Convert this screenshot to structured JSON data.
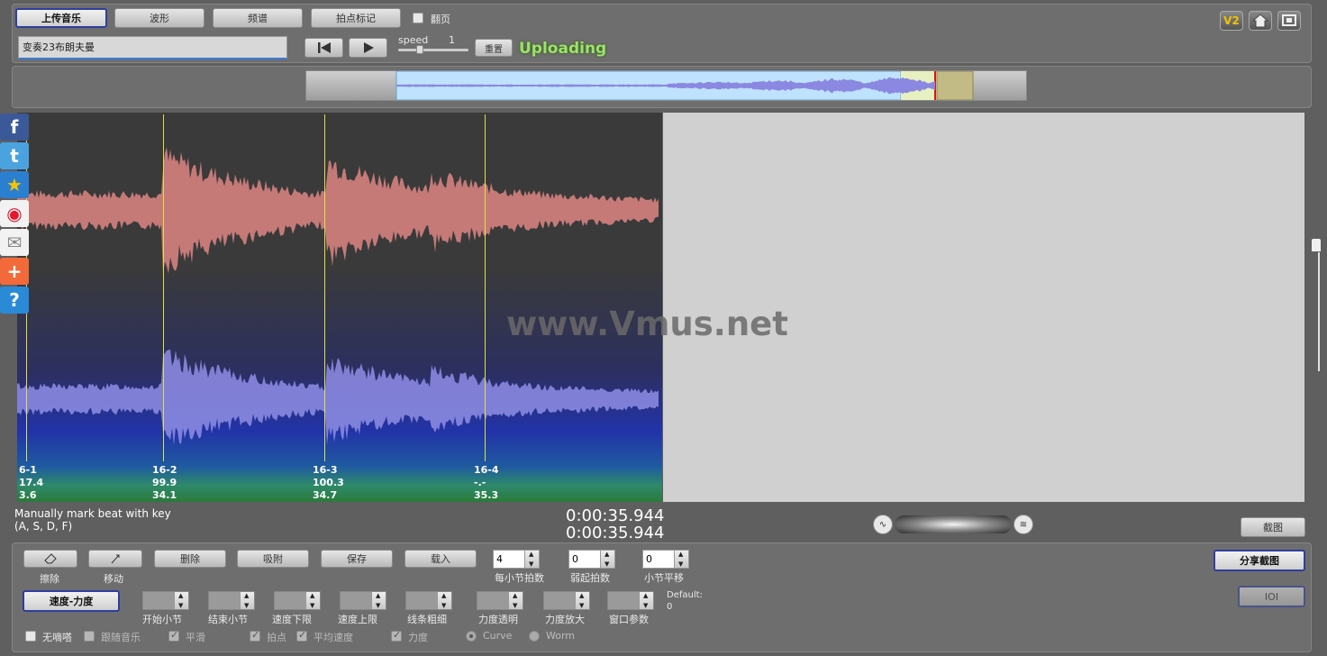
{
  "toolbar": {
    "upload": "上传音乐",
    "waveform": "波形",
    "spectrum": "频谱",
    "beat_mark": "拍点标记",
    "page_turn": "翻页",
    "file_name": "变奏23布朗夫曼",
    "speed_label": "speed",
    "speed_value": "1",
    "reset": "重置",
    "status": "Uploading",
    "v2": "V2"
  },
  "watermark": "www.Vmus.net",
  "beats": [
    {
      "id": "6-1",
      "tempo": "17.4",
      "force": "3.6"
    },
    {
      "id": "16-2",
      "tempo": "99.9",
      "force": "34.1"
    },
    {
      "id": "16-3",
      "tempo": "100.3",
      "force": "34.7"
    },
    {
      "id": "16-4",
      "tempo": "-.-",
      "force": "35.3"
    }
  ],
  "hint": {
    "line1": "Manually mark beat with key",
    "line2": "(A, S, D, F)"
  },
  "time": {
    "current": "0:00:35.944",
    "total": "0:00:35.944"
  },
  "screenshot_btn": "截图",
  "bottom": {
    "erase": "擦除",
    "move": "移动",
    "delete": "删除",
    "snap": "吸附",
    "save": "保存",
    "load": "载入",
    "beats_per_bar": {
      "label": "每小节拍数",
      "value": "4"
    },
    "pickup": {
      "label": "弱起拍数",
      "value": "0"
    },
    "bar_offset": {
      "label": "小节平移",
      "value": "0"
    },
    "share": "分享截图",
    "ioi": "IOI",
    "tempo_force": "速度-力度",
    "start_bar": "开始小节",
    "end_bar": "结束小节",
    "tempo_min": "速度下限",
    "tempo_max": "速度上限",
    "line_width": "线条粗细",
    "force_alpha": "力度透明",
    "force_zoom": "力度放大",
    "window_param": "窗口参数",
    "default_label": "Default:",
    "default_value": "0",
    "no_beep": "无嘀嗒",
    "follow_music": "跟随音乐",
    "smooth": "平滑",
    "beat_points": "拍点",
    "avg_tempo": "平均速度",
    "force": "力度",
    "curve": "Curve",
    "worm": "Worm"
  },
  "icons": [
    "facebook-icon",
    "twitter-icon",
    "star-icon",
    "weibo-icon",
    "mail-icon",
    "plus-icon",
    "help-icon",
    "home-icon",
    "fullscreen-icon"
  ],
  "colors": {
    "waveform_top": "#c57a78",
    "waveform_bottom": "#8a88e0",
    "beat_line": "#e0e044",
    "status_green": "#9de26a"
  }
}
